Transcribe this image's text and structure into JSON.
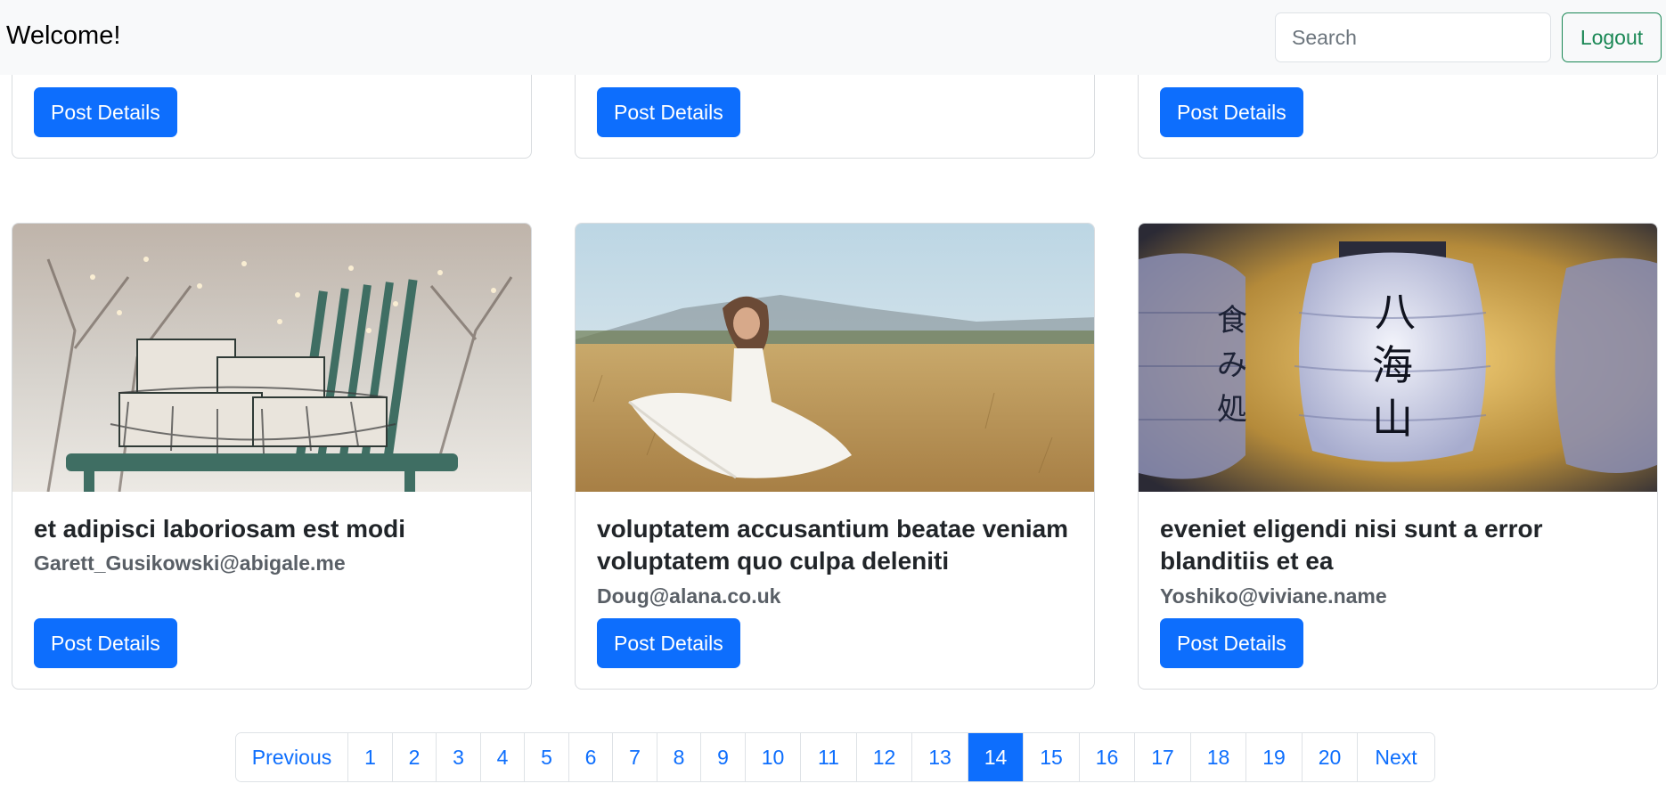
{
  "navbar": {
    "brand": "Welcome!",
    "search_placeholder": "Search",
    "logout_label": "Logout"
  },
  "cards_top": [
    {
      "button_label": "Post Details"
    },
    {
      "button_label": "Post Details"
    },
    {
      "button_label": "Post Details"
    }
  ],
  "cards": [
    {
      "image": "chair-with-gift-boxes-photo",
      "title": "et adipisci laboriosam est modi",
      "email": "Garett_Gusikowski@abigale.me",
      "button_label": "Post Details"
    },
    {
      "image": "woman-in-white-dress-field-photo",
      "title": "voluptatem accusantium beatae veniam voluptatem quo culpa deleniti",
      "email": "Doug@alana.co.uk",
      "button_label": "Post Details"
    },
    {
      "image": "paper-lanterns-photo",
      "title": "eveniet eligendi nisi sunt a error blanditiis et ea",
      "email": "Yoshiko@viviane.name",
      "button_label": "Post Details"
    }
  ],
  "pagination": {
    "previous": "Previous",
    "pages": [
      "1",
      "2",
      "3",
      "4",
      "5",
      "6",
      "7",
      "8",
      "9",
      "10",
      "11",
      "12",
      "13",
      "14",
      "15",
      "16",
      "17",
      "18",
      "19",
      "20"
    ],
    "active": "14",
    "next": "Next"
  },
  "colors": {
    "primary": "#0d6efd",
    "success": "#198754",
    "navbar_bg": "#f8f9fa"
  }
}
